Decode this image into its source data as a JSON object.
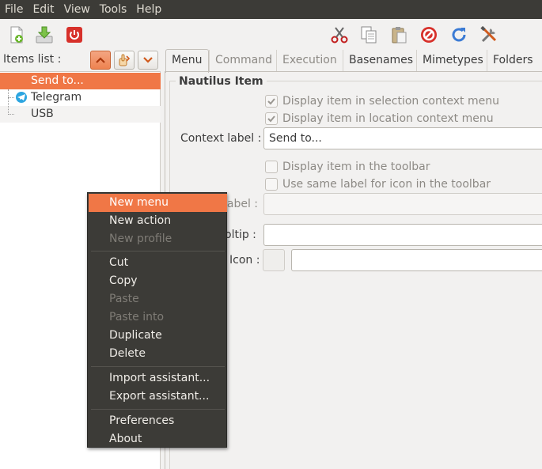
{
  "menubar": {
    "items": [
      "File",
      "Edit",
      "View",
      "Tools",
      "Help"
    ]
  },
  "toolbar": {
    "icons": [
      "new-document-icon",
      "save-download-icon",
      "quit-power-icon",
      "cut-scissors-icon",
      "copy-icon",
      "paste-icon",
      "delete-stop-icon",
      "reload-icon",
      "preferences-tools-icon"
    ]
  },
  "items_list": {
    "label": "Items list :",
    "rows": [
      {
        "label": "Send to...",
        "selected": true
      },
      {
        "label": "Telegram",
        "icon": "telegram-icon"
      },
      {
        "label": "USB"
      }
    ]
  },
  "tabs": [
    {
      "label": "Menu",
      "current": true
    },
    {
      "label": "Command",
      "disabled": true
    },
    {
      "label": "Execution",
      "disabled": true
    },
    {
      "label": "Basenames"
    },
    {
      "label": "Mimetypes"
    },
    {
      "label": "Folders"
    }
  ],
  "nautilus_item": {
    "title": "Nautilus Item",
    "display_selection": "Display item in selection context menu",
    "display_location": "Display item in location context menu",
    "context_label": "Context label :",
    "context_value": "Send to...",
    "display_toolbar": "Display item in the toolbar",
    "same_label": "Use same label for icon in the toolbar",
    "label_label": "label :",
    "tooltip_label": "oltip :",
    "icon_label": "Icon :"
  },
  "context_menu": {
    "items": [
      {
        "label": "New menu",
        "highlighted": true
      },
      {
        "label": "New action"
      },
      {
        "label": "New profile",
        "disabled": true
      },
      {
        "label": "Cut"
      },
      {
        "label": "Copy"
      },
      {
        "label": "Paste",
        "disabled": true
      },
      {
        "label": "Paste into",
        "disabled": true
      },
      {
        "label": "Duplicate"
      },
      {
        "label": "Delete"
      },
      {
        "label": "Import assistant..."
      },
      {
        "label": "Export assistant..."
      },
      {
        "label": "Preferences"
      },
      {
        "label": "About"
      }
    ]
  },
  "colors": {
    "accent": "#f07746",
    "menubar_bg": "#3c3b37",
    "window_bg": "#f2f1f0"
  }
}
